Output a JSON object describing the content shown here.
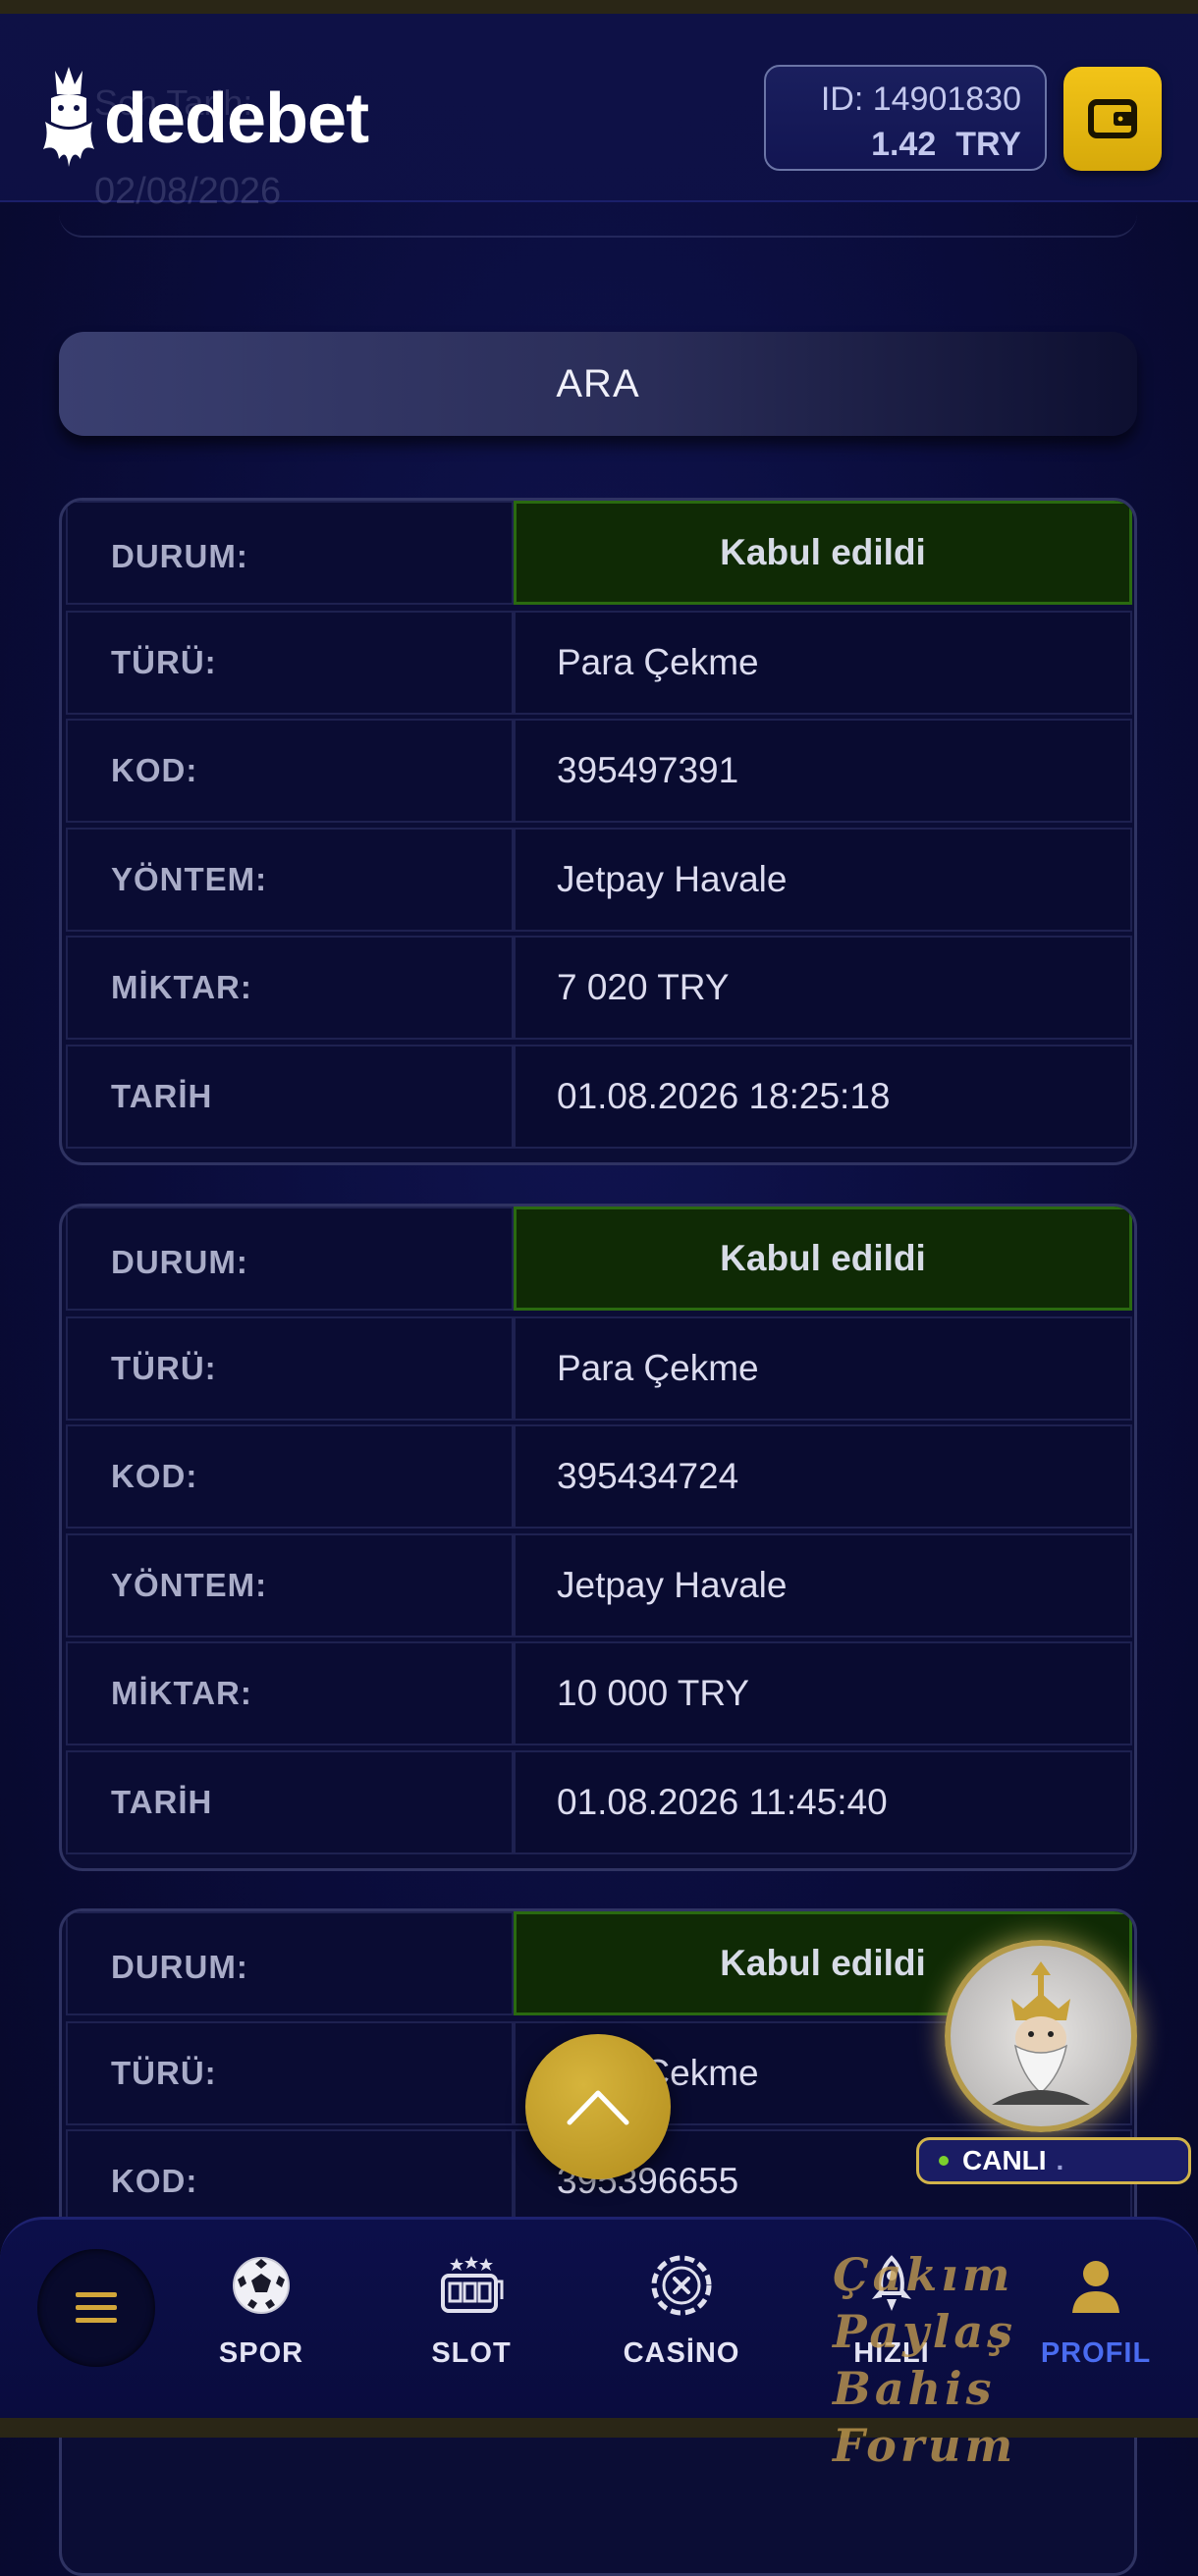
{
  "header": {
    "logo_text": "dedebet",
    "ghost_label": "Son Tarih:",
    "ghost_date": "02/08/2026",
    "account_id": "ID: 14901830",
    "balance_amount": "1.42",
    "balance_currency": "TRY",
    "wallet_icon": "wallet-icon"
  },
  "search_button_label": "ARA",
  "transactions": [
    {
      "status_label": "DURUM:",
      "status": "Kabul edildi",
      "type_label": "TÜRÜ:",
      "type": "Para Çekme",
      "code_label": "KOD:",
      "code": "395497391",
      "method_label": "YÖNTEM:",
      "method": "Jetpay Havale",
      "amount_label": "MİKTAR:",
      "amount": "7 020 TRY",
      "date_label": "TARİH",
      "date": "01.08.2026 18:25:18"
    },
    {
      "status_label": "DURUM:",
      "status": "Kabul edildi",
      "type_label": "TÜRÜ:",
      "type": "Para Çekme",
      "code_label": "KOD:",
      "code": "395434724",
      "method_label": "YÖNTEM:",
      "method": "Jetpay Havale",
      "amount_label": "MİKTAR:",
      "amount": "10 000 TRY",
      "date_label": "TARİH",
      "date": "01.08.2026 11:45:40"
    },
    {
      "status_label": "DURUM:",
      "status": "Kabul edildi",
      "type_label": "TÜRÜ:",
      "type": "Para Çekme",
      "code_label": "KOD:",
      "code": "395396655"
    }
  ],
  "live_widget": {
    "label": "CANLI",
    "trail": "."
  },
  "watermark": {
    "line1": "Çakım Paylaş",
    "line2": "Bahis Forum"
  },
  "bottom_nav": {
    "menu_icon": "hamburger-menu-icon",
    "items": [
      {
        "label": "SPOR",
        "icon": "soccer-ball-icon"
      },
      {
        "label": "SLOT",
        "icon": "slot-machine-icon"
      },
      {
        "label": "CASİNO",
        "icon": "casino-chip-icon"
      },
      {
        "label": "HIZLI",
        "icon": "rocket-icon"
      },
      {
        "label": "PROFIL",
        "icon": "user-icon"
      }
    ]
  },
  "colors": {
    "background": "#0a0c3a",
    "accent_gold": "#f2c418",
    "status_green": "#0f2a05",
    "active_nav": "#4a6cf0"
  }
}
